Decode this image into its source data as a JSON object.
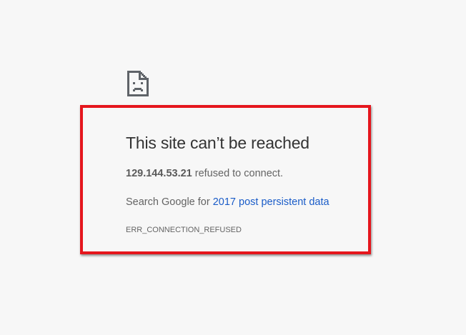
{
  "error": {
    "icon": "sad-file-icon",
    "title": "This site can’t be reached",
    "host": "129.144.53.21",
    "host_suffix": " refused to connect.",
    "search_prefix": "Search Google for ",
    "search_query": "2017 post persistent data",
    "code": "ERR_CONNECTION_REFUSED"
  },
  "colors": {
    "background": "#f7f7f7",
    "highlight_border": "#e5161d",
    "link": "#1a5cc8",
    "title_text": "#333333",
    "body_text": "#646464"
  }
}
